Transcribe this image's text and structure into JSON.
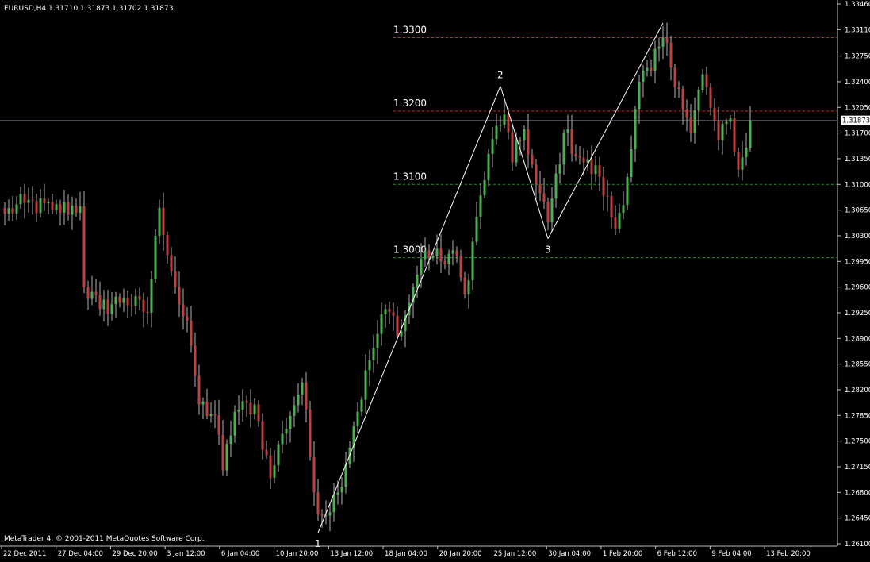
{
  "window": {
    "symbol_header": "EURUSD,H4  1.31710 1.31873 1.31702 1.31873",
    "copyright": "MetaTrader 4, © 2001-2011 MetaQuotes Software Corp."
  },
  "colors": {
    "background": "#000000",
    "bull_candle": "#4CAF50",
    "bear_candle": "#C04040",
    "wick": "#B0B0B0",
    "axis": "#C0C0C0",
    "resistance_line": "#C03030",
    "support_line": "#2E8B2E",
    "wave_line": "#FFFFFF",
    "bid_line": "#505060"
  },
  "chart_data": {
    "type": "candlestick",
    "symbol": "EURUSD",
    "timeframe": "H4",
    "ylim": [
      1.261,
      1.3346
    ],
    "price_axis_ticks": [
      "1.33460",
      "1.33110",
      "1.32750",
      "1.32400",
      "1.32050",
      "1.31700",
      "1.31350",
      "1.31000",
      "1.30650",
      "1.30300",
      "1.29950",
      "1.29600",
      "1.29250",
      "1.28900",
      "1.28550",
      "1.28200",
      "1.27850",
      "1.27500",
      "1.27150",
      "1.26800",
      "1.26450",
      "1.26100"
    ],
    "time_axis_ticks": [
      "22 Dec 2011",
      "27 Dec 04:00",
      "29 Dec 20:00",
      "3 Jan 12:00",
      "6 Jan 04:00",
      "10 Jan 20:00",
      "13 Jan 12:00",
      "18 Jan 04:00",
      "20 Jan 20:00",
      "25 Jan 12:00",
      "30 Jan 04:00",
      "1 Feb 20:00",
      "6 Feb 12:00",
      "9 Feb 04:00",
      "13 Feb 20:00"
    ],
    "current_price": "1.31873",
    "level_lines": [
      {
        "label": "1.3300",
        "value": 1.33,
        "kind": "resistance"
      },
      {
        "label": "1.3200",
        "value": 1.32,
        "kind": "resistance"
      },
      {
        "label": "1.3100",
        "value": 1.31,
        "kind": "support"
      },
      {
        "label": "1.3000",
        "value": 1.3,
        "kind": "support"
      }
    ],
    "wave_points": [
      {
        "label": "1",
        "bar": 79,
        "price": 1.2625
      },
      {
        "label": "2",
        "bar": 125,
        "price": 1.3234
      },
      {
        "label": "3",
        "bar": 137,
        "price": 1.3026
      },
      {
        "label": "",
        "bar": 166,
        "price": 1.332
      }
    ],
    "anchors": [
      [
        0,
        1.306
      ],
      [
        5,
        1.3075
      ],
      [
        12,
        1.3065
      ],
      [
        19,
        1.307
      ],
      [
        20,
        1.296
      ],
      [
        24,
        1.293
      ],
      [
        30,
        1.2945
      ],
      [
        36,
        1.2925
      ],
      [
        39,
        1.3068
      ],
      [
        43,
        1.296
      ],
      [
        47,
        1.288
      ],
      [
        49,
        1.28
      ],
      [
        53,
        1.2785
      ],
      [
        55,
        1.271
      ],
      [
        58,
        1.279
      ],
      [
        63,
        1.28
      ],
      [
        67,
        1.27
      ],
      [
        70,
        1.276
      ],
      [
        75,
        1.283
      ],
      [
        78,
        1.268
      ],
      [
        80,
        1.2648
      ],
      [
        84,
        1.268
      ],
      [
        88,
        1.277
      ],
      [
        92,
        1.286
      ],
      [
        96,
        1.293
      ],
      [
        100,
        1.29
      ],
      [
        103,
        1.296
      ],
      [
        106,
        1.301
      ],
      [
        110,
        1.2995
      ],
      [
        113,
        1.301
      ],
      [
        116,
        1.295
      ],
      [
        120,
        1.3085
      ],
      [
        124,
        1.318
      ],
      [
        126,
        1.3195
      ],
      [
        128,
        1.313
      ],
      [
        131,
        1.3175
      ],
      [
        134,
        1.31
      ],
      [
        137,
        1.3048
      ],
      [
        141,
        1.317
      ],
      [
        146,
        1.313
      ],
      [
        150,
        1.311
      ],
      [
        154,
        1.304
      ],
      [
        157,
        1.311
      ],
      [
        160,
        1.324
      ],
      [
        163,
        1.3255
      ],
      [
        166,
        1.33
      ],
      [
        170,
        1.323
      ],
      [
        173,
        1.317
      ],
      [
        176,
        1.325
      ],
      [
        180,
        1.316
      ],
      [
        183,
        1.319
      ],
      [
        185,
        1.312
      ],
      [
        187,
        1.315
      ],
      [
        188,
        1.3187
      ]
    ]
  }
}
